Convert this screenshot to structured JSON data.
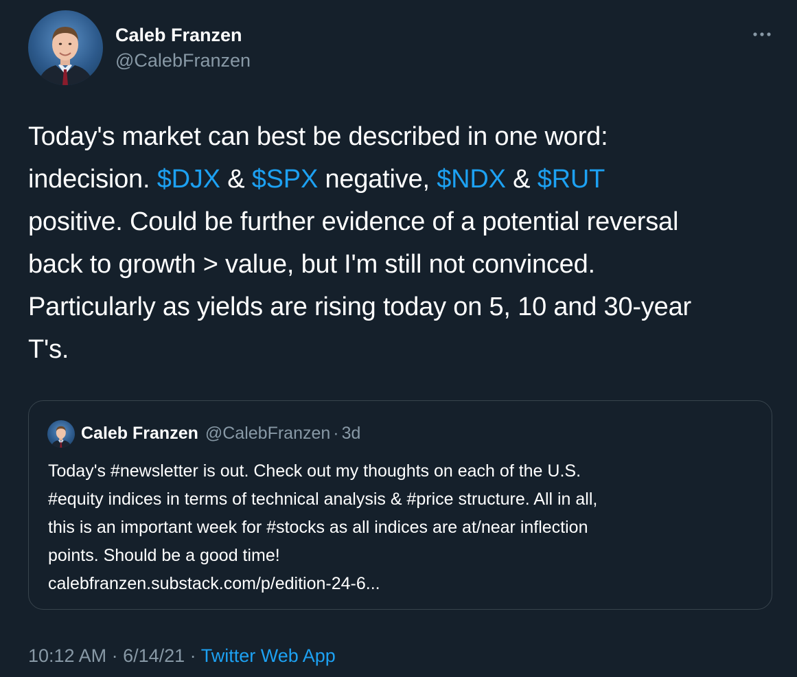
{
  "author": {
    "name": "Caleb Franzen",
    "handle": "@CalebFranzen"
  },
  "tweet": {
    "lines": [
      [
        {
          "t": "Today's market can best be described in one word:"
        }
      ],
      [
        {
          "t": "indecision. "
        },
        {
          "t": "$DJX",
          "tag": true
        },
        {
          "t": " & "
        },
        {
          "t": "$SPX",
          "tag": true
        },
        {
          "t": " negative, "
        },
        {
          "t": "$NDX",
          "tag": true
        },
        {
          "t": " & "
        },
        {
          "t": "$RUT",
          "tag": true
        }
      ],
      [
        {
          "t": "positive. Could be further evidence of a potential reversal"
        }
      ],
      [
        {
          "t": "back to growth > value, but I'm still not convinced."
        }
      ],
      [
        {
          "t": "Particularly as yields are rising today on 5, 10 and 30-year"
        }
      ],
      [
        {
          "t": "T's."
        }
      ]
    ]
  },
  "quoted_tweet": {
    "name": "Caleb Franzen",
    "handle": "@CalebFranzen",
    "separator": "·",
    "age": "3d",
    "lines": [
      "Today's #newsletter is out. Check out my thoughts on each of the U.S.",
      "#equity indices in terms of technical analysis & #price structure. All in all,",
      "this is an important week for #stocks as all indices are at/near inflection",
      "points. Should be a good time!",
      "calebfranzen.substack.com/p/edition-24-6..."
    ]
  },
  "meta": {
    "time": "10:12 AM",
    "separator1": " · ",
    "date": "6/14/21",
    "separator2": " · ",
    "source": "Twitter Web App"
  },
  "icons": {
    "more": "more-horizontal-icon"
  },
  "colors": {
    "background": "#15202b",
    "text": "#ffffff",
    "secondary": "#8899a6",
    "link": "#1da1f2",
    "border": "#38444d"
  }
}
